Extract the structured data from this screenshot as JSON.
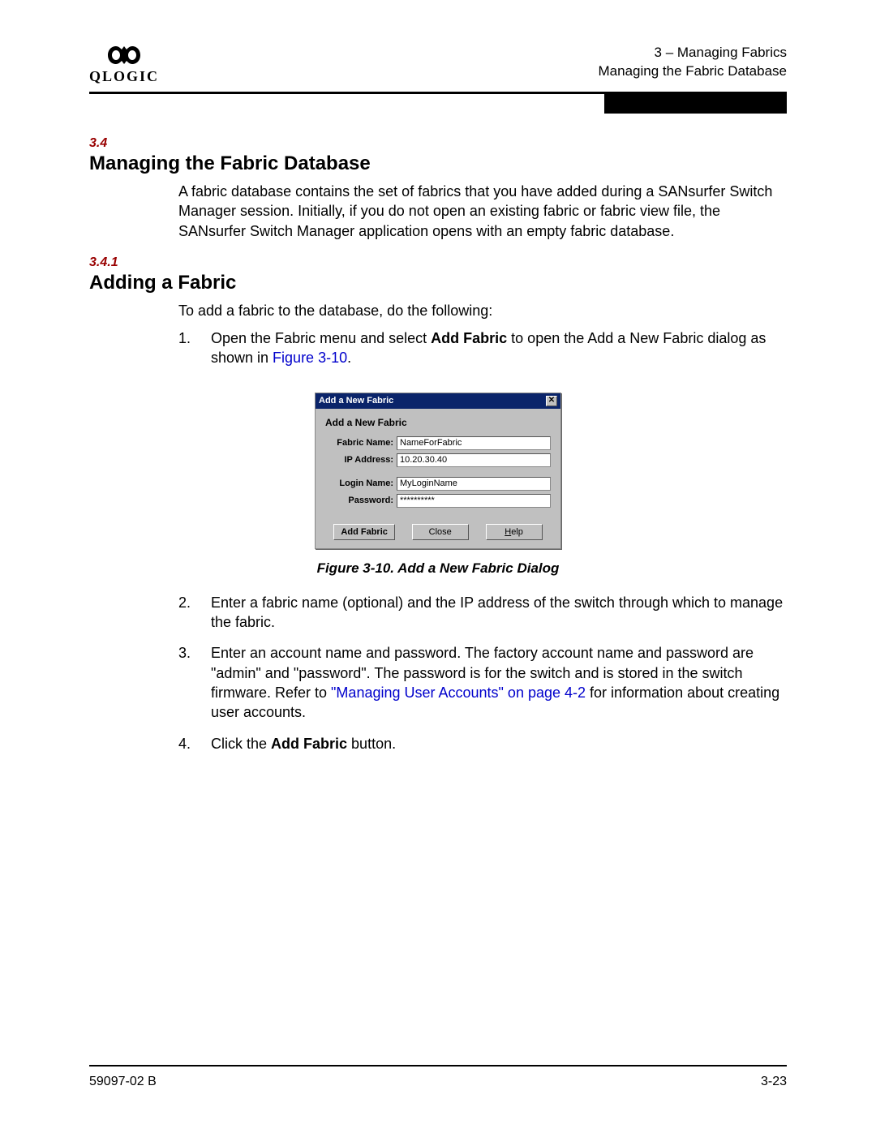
{
  "header": {
    "brand": "QLOGIC",
    "line1": "3 – Managing Fabrics",
    "line2": "Managing the Fabric Database"
  },
  "section34": {
    "num": "3.4",
    "title": "Managing the Fabric Database",
    "para": "A fabric database contains the set of fabrics that you have added during a SANsurfer Switch Manager session. Initially, if you do not open an existing fabric or fabric view file, the SANsurfer Switch Manager application opens with an empty fabric database."
  },
  "section341": {
    "num": "3.4.1",
    "title": "Adding a Fabric",
    "intro": "To add a fabric to the database, do the following:"
  },
  "steps": {
    "s1_pre": "Open the Fabric menu and select ",
    "s1_bold": "Add Fabric",
    "s1_mid": " to open the Add a New Fabric dialog as shown in ",
    "s1_link": "Figure 3-10",
    "s1_post": ".",
    "s2": "Enter a fabric name (optional) and the IP address of the switch through which to manage the fabric.",
    "s3_pre": "Enter an account name and password. The factory account name and password are \"admin\" and \"password\". The password is for the switch and is stored in the switch firmware. Refer to ",
    "s3_link": "\"Managing User Accounts\" on page 4-2",
    "s3_post": " for information about creating user accounts.",
    "s4_pre": "Click the ",
    "s4_bold": "Add Fabric",
    "s4_post": " button."
  },
  "dialog": {
    "title": "Add a New Fabric",
    "heading": "Add a New Fabric",
    "labels": {
      "fabric": "Fabric Name:",
      "ip": "IP Address:",
      "login": "Login Name:",
      "password": "Password:"
    },
    "values": {
      "fabric": "NameForFabric",
      "ip": "10.20.30.40",
      "login": "MyLoginName",
      "password": "**********"
    },
    "buttons": {
      "add": "Add Fabric",
      "close": "Close",
      "help": "Help"
    }
  },
  "figcaption": "Figure 3-10.  Add a New Fabric Dialog",
  "footer": {
    "left": "59097-02 B",
    "right": "3-23"
  }
}
